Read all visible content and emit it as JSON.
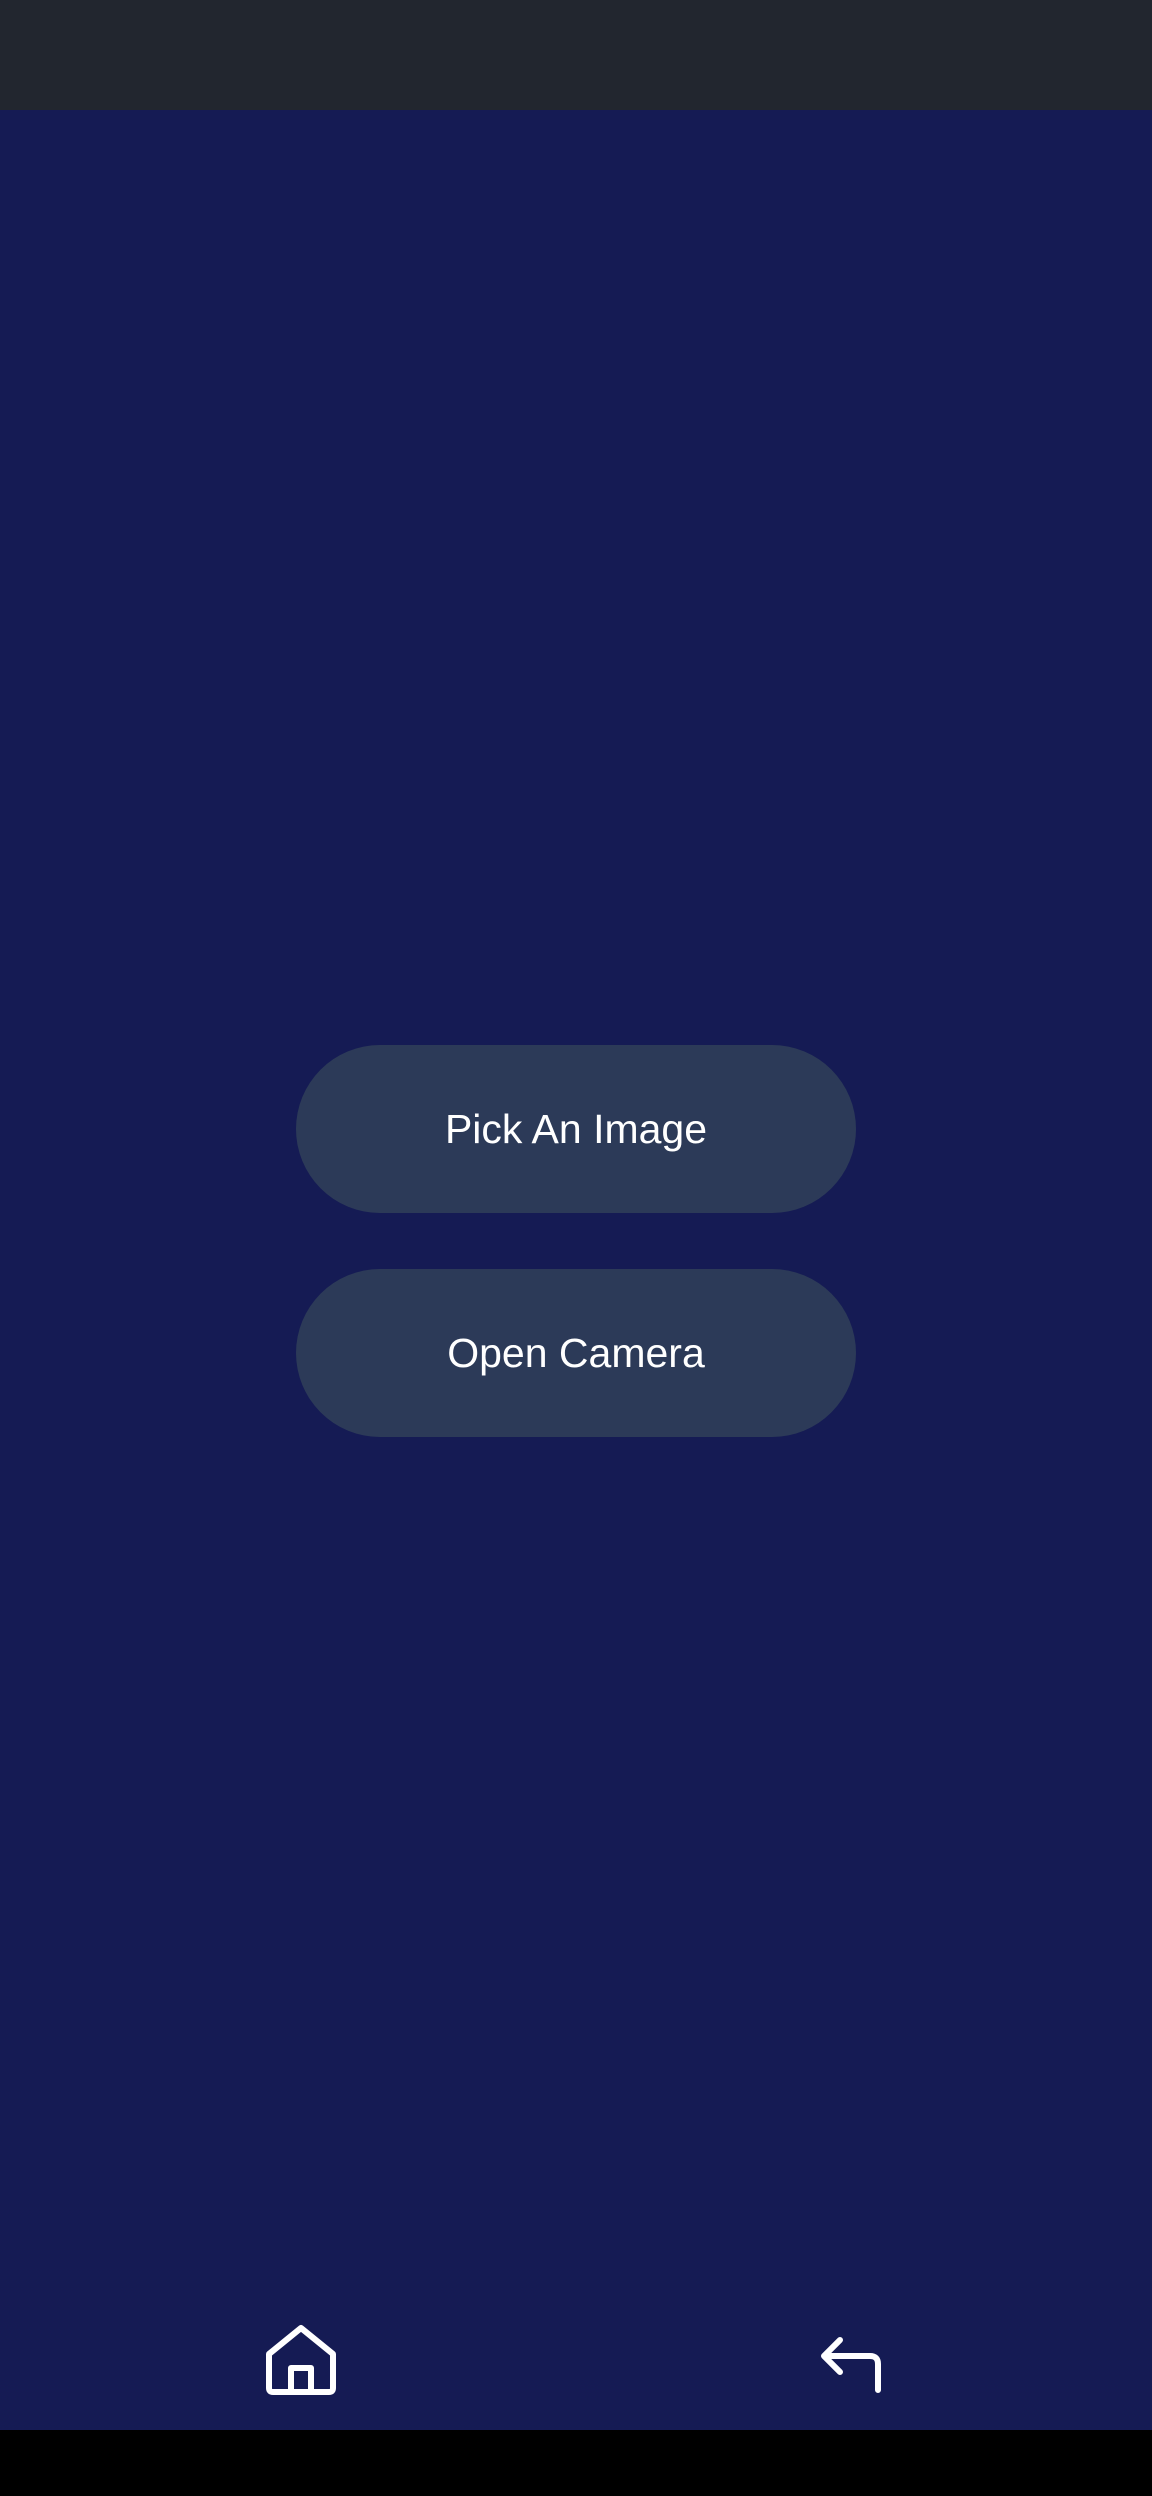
{
  "status_bar": {
    "color": "#22262f"
  },
  "main": {
    "background": "#151b54",
    "pick_image_label": "Pick An Image",
    "open_camera_label": "Open Camera",
    "button_color": "#2c3a58"
  },
  "nav": {
    "home_icon": "home-icon",
    "back_icon": "back-icon"
  }
}
